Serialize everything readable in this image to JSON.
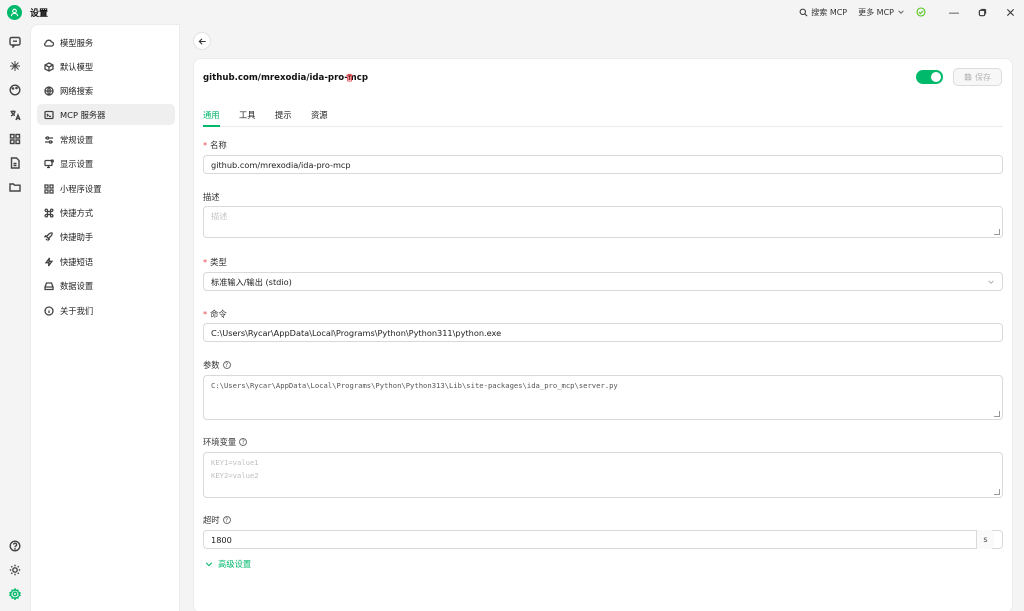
{
  "app": {
    "title": "设置",
    "accent": "#00b96b"
  },
  "titlebar": {
    "search_mcp": "搜索 MCP",
    "more_mcp": "更多 MCP"
  },
  "sidebar": {
    "items": [
      {
        "label": "模型服务",
        "icon": "cloud-icon"
      },
      {
        "label": "默认模型",
        "icon": "cube-icon"
      },
      {
        "label": "网络搜索",
        "icon": "globe-icon"
      },
      {
        "label": "MCP 服务器",
        "icon": "terminal-icon",
        "active": true
      },
      {
        "label": "常规设置",
        "icon": "sliders-icon"
      },
      {
        "label": "显示设置",
        "icon": "monitor-icon"
      },
      {
        "label": "小程序设置",
        "icon": "grid-icon"
      },
      {
        "label": "快捷方式",
        "icon": "command-icon"
      },
      {
        "label": "快捷助手",
        "icon": "rocket-icon"
      },
      {
        "label": "快捷短语",
        "icon": "zap-icon"
      },
      {
        "label": "数据设置",
        "icon": "drive-icon"
      },
      {
        "label": "关于我们",
        "icon": "info-icon"
      }
    ]
  },
  "server": {
    "title": "github.com/mrexodia/ida-pro-mcp",
    "save_label": "保存",
    "enabled": true
  },
  "tabs": [
    "通用",
    "工具",
    "提示",
    "资源"
  ],
  "form": {
    "name_label": "名称",
    "name_value": "github.com/mrexodia/ida-pro-mcp",
    "desc_label": "描述",
    "desc_placeholder": "描述",
    "type_label": "类型",
    "type_value": "标准输入/输出 (stdio)",
    "command_label": "命令",
    "command_value": "C:\\Users\\Rycar\\AppData\\Local\\Programs\\Python\\Python311\\python.exe",
    "args_label": "参数",
    "args_value": "C:\\Users\\Rycar\\AppData\\Local\\Programs\\Python\\Python313\\Lib\\site-packages\\ida_pro_mcp\\server.py",
    "env_label": "环境变量",
    "env_placeholder_1": "KEY1=value1",
    "env_placeholder_2": "KEY2=value2",
    "timeout_label": "超时",
    "timeout_value": "1800",
    "timeout_unit": "s",
    "advanced_label": "高级设置"
  }
}
